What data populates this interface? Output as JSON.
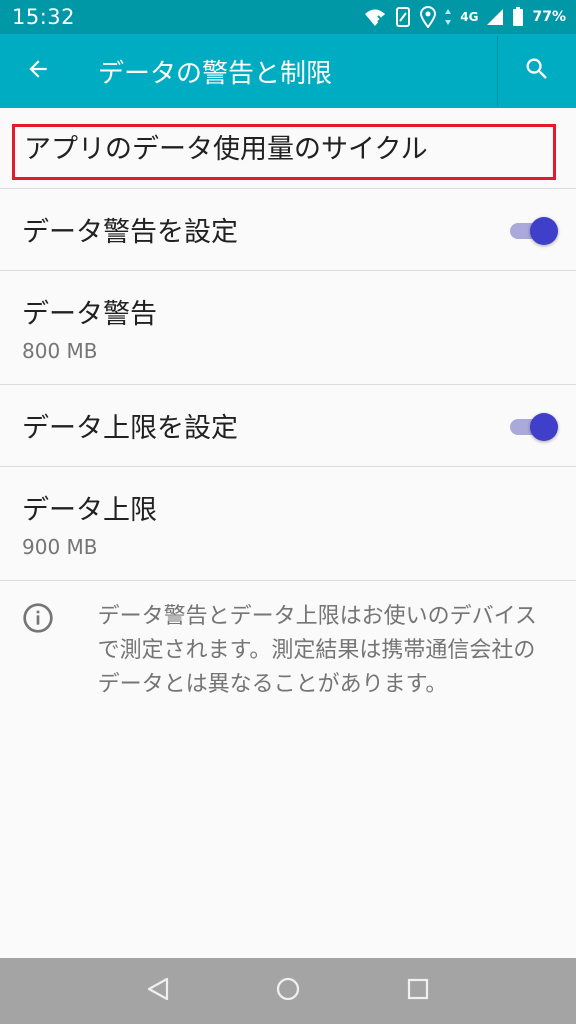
{
  "status_bar": {
    "time": "15:32",
    "network": "4G",
    "battery": "77%"
  },
  "app_bar": {
    "title": "データの警告と制限",
    "back_icon": "arrow-left-icon",
    "search_icon": "search-icon"
  },
  "list": {
    "cycle": {
      "title": "アプリのデータ使用量のサイクル"
    },
    "warning_toggle": {
      "title": "データ警告を設定",
      "on": true
    },
    "warning_value": {
      "title": "データ警告",
      "value": "800 MB"
    },
    "limit_toggle": {
      "title": "データ上限を設定",
      "on": true
    },
    "limit_value": {
      "title": "データ上限",
      "value": "900 MB"
    }
  },
  "info": {
    "icon": "info-icon",
    "text": "データ警告とデータ上限はお使いのデバイスで測定されます。測定結果は携帯通信会社のデータとは異なることがあります。"
  },
  "colors": {
    "status_bar": "#0097a7",
    "app_bar": "#00acc1",
    "toggle_thumb": "#3f3fc9",
    "highlight": "#e5192c"
  }
}
